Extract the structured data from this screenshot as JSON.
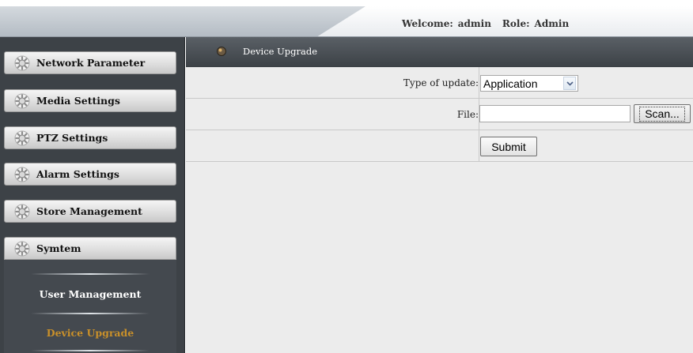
{
  "topbar": {
    "welcome_label": "Welcome:",
    "user": "admin",
    "role_label": "Role:",
    "role": "Admin"
  },
  "sidebar": {
    "menu": [
      {
        "label": "Network Parameter",
        "icon": "gear-icon"
      },
      {
        "label": "Media Settings",
        "icon": "gear-icon"
      },
      {
        "label": "PTZ Settings",
        "icon": "gear-icon"
      },
      {
        "label": "Alarm Settings",
        "icon": "gear-icon"
      },
      {
        "label": "Store Management",
        "icon": "gear-icon"
      },
      {
        "label": "Symtem",
        "icon": "gear-icon"
      }
    ],
    "submenu": [
      {
        "label": "User Management",
        "state": "normal"
      },
      {
        "label": "Device Upgrade",
        "state": "selected"
      }
    ]
  },
  "content": {
    "header_title": "Device Upgrade",
    "header_icon": "bullet-icon",
    "type_label": "Type of update:",
    "type_value": "Application",
    "file_label": "File:",
    "file_value": "",
    "scan_label": "Scan...",
    "submit_label": "Submit"
  },
  "colors": {
    "sidebar_bg": "#3d4247",
    "submenu_normal": "#ffffff",
    "submenu_selected": "#c9902a",
    "content_bg": "#ececec"
  }
}
